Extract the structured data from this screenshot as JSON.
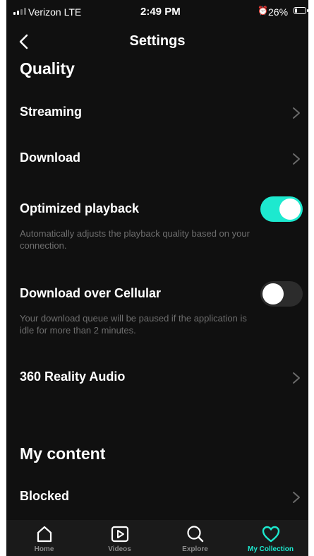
{
  "status_bar": {
    "carrier": "Verizon  LTE",
    "time": "2:49 PM",
    "battery": "26%",
    "battery_level": 0.26
  },
  "header": {
    "title": "Settings",
    "back_icon": "chevron-left-icon"
  },
  "sections": {
    "quality_title": "Quality",
    "my_content_title": "My content"
  },
  "rows": {
    "streaming": {
      "label": "Streaming"
    },
    "download": {
      "label": "Download"
    },
    "optimized_playback": {
      "label": "Optimized playback",
      "description": "Automatically adjusts the playback quality based on your connection.",
      "enabled": true
    },
    "download_cellular": {
      "label": "Download over Cellular",
      "description": "Your download queue will be paused if the application is idle for more than 2 minutes.",
      "enabled": false
    },
    "reality_audio": {
      "label": "360 Reality Audio"
    },
    "blocked": {
      "label": "Blocked"
    }
  },
  "tab_bar": {
    "tabs": [
      {
        "label": "Home",
        "icon": "home-icon"
      },
      {
        "label": "Videos",
        "icon": "video-play-icon"
      },
      {
        "label": "Explore",
        "icon": "search-icon"
      },
      {
        "label": "My Collection",
        "icon": "heart-icon"
      }
    ],
    "active_index": 3
  },
  "colors": {
    "accent": "#1de9cf",
    "background": "#101010",
    "secondary_text": "#6e6e6e"
  }
}
